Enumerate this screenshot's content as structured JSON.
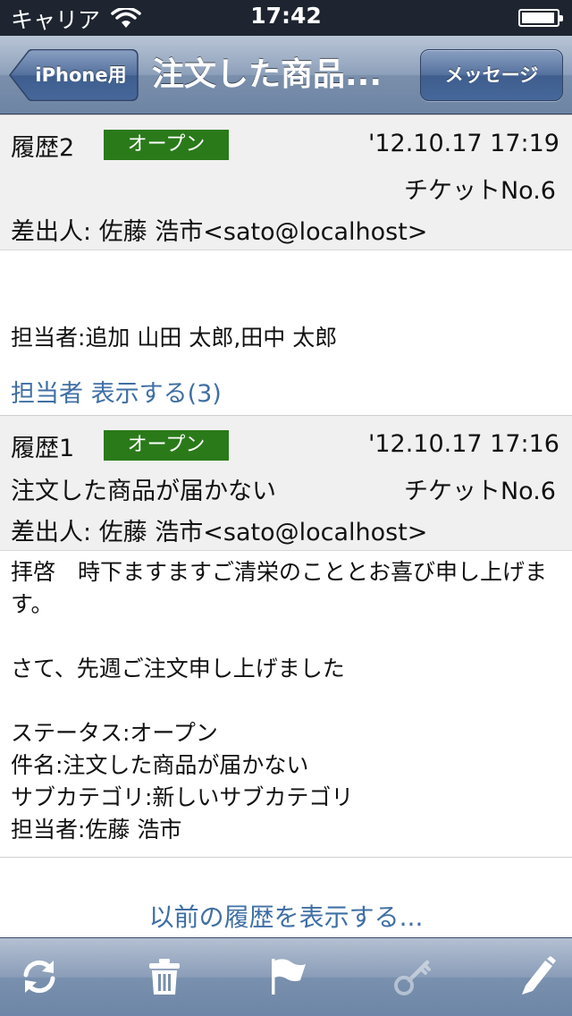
{
  "status_bar": {
    "carrier": "キャリア",
    "time": "17:42"
  },
  "nav": {
    "back_label": "iPhone用",
    "title": "注文した商品...",
    "message_button": "メッセージ"
  },
  "history2": {
    "label": "履歴2",
    "status": "オープン",
    "date": "'12.10.17 17:19",
    "ticket": "チケットNo.6",
    "sender": "差出人: 佐藤 浩市<sato@localhost>",
    "body": "担当者:追加 山田 太郎,田中 太郎",
    "assignee_link": "担当者 表示する(3)"
  },
  "history1": {
    "label": "履歴1",
    "status": "オープン",
    "date": "'12.10.17 17:16",
    "subject": "注文した商品が届かない",
    "ticket": "チケットNo.6",
    "sender": "差出人: 佐藤 浩市<sato@localhost>",
    "body": "拝啓　時下ますますご清栄のこととお喜び申し上げます。\n\nさて、先週ご注文申し上げました\n\nステータス:オープン\n件名:注文した商品が届かない\nサブカテゴリ:新しいサブカテゴリ\n担当者:佐藤 浩市"
  },
  "show_previous_link": "以前の履歴を表示する...",
  "toolbar": {
    "icons": [
      "refresh-icon",
      "trash-icon",
      "flag-icon",
      "key-icon",
      "compose-icon"
    ],
    "key_disabled": true
  },
  "colors": {
    "status_badge": "#2a7a1a",
    "link": "#3f6fa5",
    "nav_bar": "#7a8fab"
  }
}
